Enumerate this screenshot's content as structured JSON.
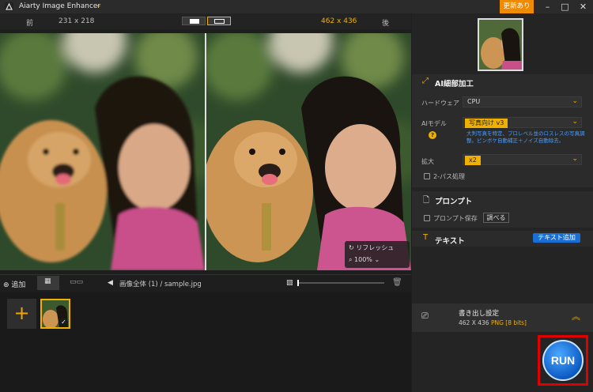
{
  "app": {
    "title": "Aiarty Image Enhancer",
    "update_label": "更新あり"
  },
  "info": {
    "before_label": "前",
    "before_size": "231 x 218",
    "after_size": "462 x 436",
    "after_label": "後"
  },
  "viewer": {
    "refresh_label": "リフレッシュ",
    "zoom": "100%"
  },
  "toolbar": {
    "add_label": "追加",
    "breadcrumb": "画像全体 (1)",
    "separator": "/",
    "file": "sample.jpg"
  },
  "panel": {
    "ai_section": "AI細部加工",
    "hardware_label": "ハードウェア",
    "hardware_value": "CPU",
    "model_label": "AIモデル",
    "model_value": "写真向け v3",
    "model_desc": "大判写真を特定、プロレベル並のロスレスの写真調整。ピンボケ自動補正＋ノイズ自動除去。",
    "scale_label": "拡大",
    "scale_value": "x2",
    "twopass_label": "2-パス処理",
    "prompt_section": "プロンプト",
    "prompt_save_label": "プロンプト保存",
    "prompt_search_button": "調べる",
    "text_section": "テキスト",
    "text_add_button": "テキスト追加",
    "export_title": "書き出し設定",
    "export_size": "462 X 436",
    "export_format": "PNG",
    "export_bits": "[8 bits]",
    "run_label": "RUN"
  },
  "colors": {
    "accent": "#f0b000",
    "update": "#f08a00",
    "blue": "#1a6fd6",
    "run_frame": "#e00000"
  }
}
